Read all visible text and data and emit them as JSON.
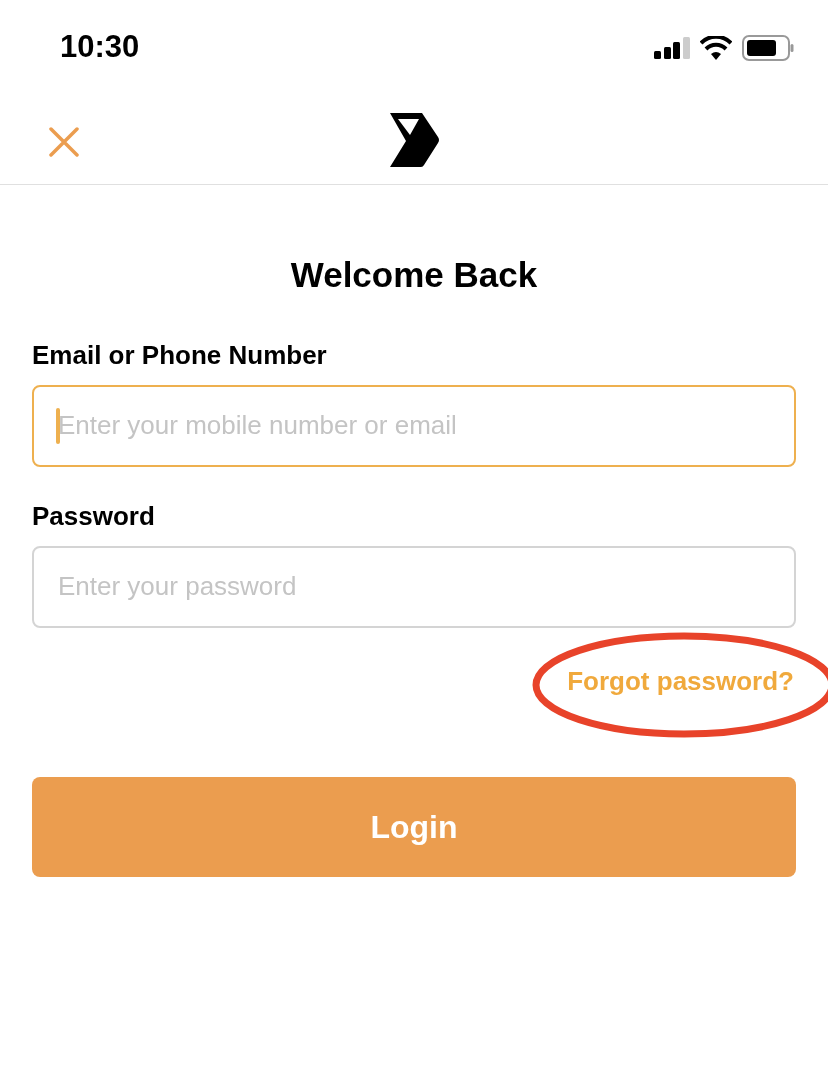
{
  "status_bar": {
    "time": "10:30"
  },
  "title": "Welcome Back",
  "fields": [
    {
      "label": "Email or Phone Number",
      "placeholder": "Enter your mobile number or email",
      "focused": true
    },
    {
      "label": "Password",
      "placeholder": "Enter your password",
      "focused": false
    }
  ],
  "forgot_link": {
    "text": "Forgot password?",
    "circled": true
  },
  "login_button": "Login"
}
